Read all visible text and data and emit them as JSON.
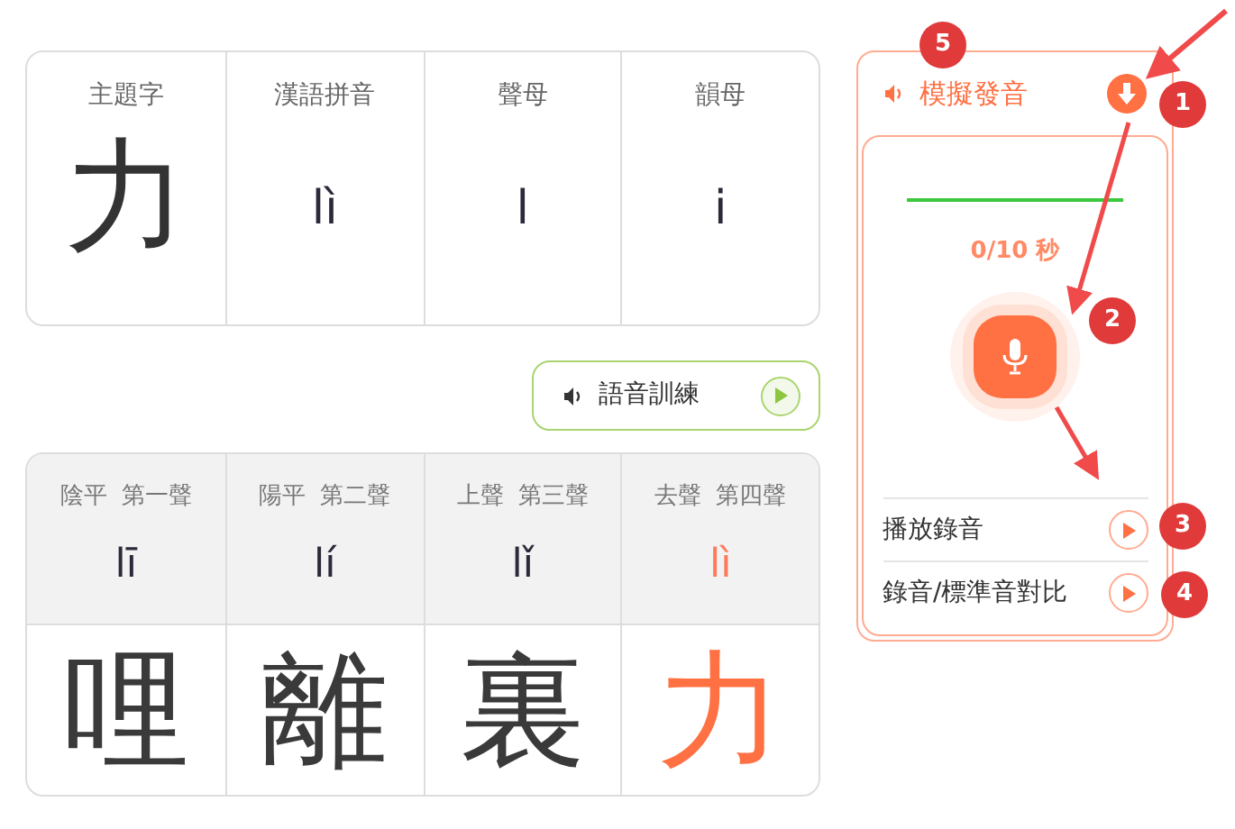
{
  "summary": {
    "columns": [
      {
        "heading": "主題字",
        "value": "力",
        "kind": "character"
      },
      {
        "heading": "漢語拼音",
        "value": "lì",
        "kind": "pinyin"
      },
      {
        "heading": "聲母",
        "value": "l",
        "kind": "pinyin"
      },
      {
        "heading": "韻母",
        "value": "i",
        "kind": "pinyin"
      }
    ]
  },
  "voice_training": {
    "label": "語音訓練"
  },
  "tones": [
    {
      "name": "陰平",
      "ordinal": "第一聲",
      "pinyin": "lī",
      "character": "哩",
      "selected": false
    },
    {
      "name": "陽平",
      "ordinal": "第二聲",
      "pinyin": "lí",
      "character": "離",
      "selected": false
    },
    {
      "name": "上聲",
      "ordinal": "第三聲",
      "pinyin": "lǐ",
      "character": "裏",
      "selected": false
    },
    {
      "name": "去聲",
      "ordinal": "第四聲",
      "pinyin": "lì",
      "character": "力",
      "selected": true
    }
  ],
  "simulator": {
    "title": "模擬發音",
    "timer": "0/10 秒",
    "actions": [
      {
        "label": "播放錄音"
      },
      {
        "label": "錄音/標準音對比"
      }
    ]
  },
  "annotations": [
    "5",
    "1",
    "2",
    "3",
    "4"
  ]
}
